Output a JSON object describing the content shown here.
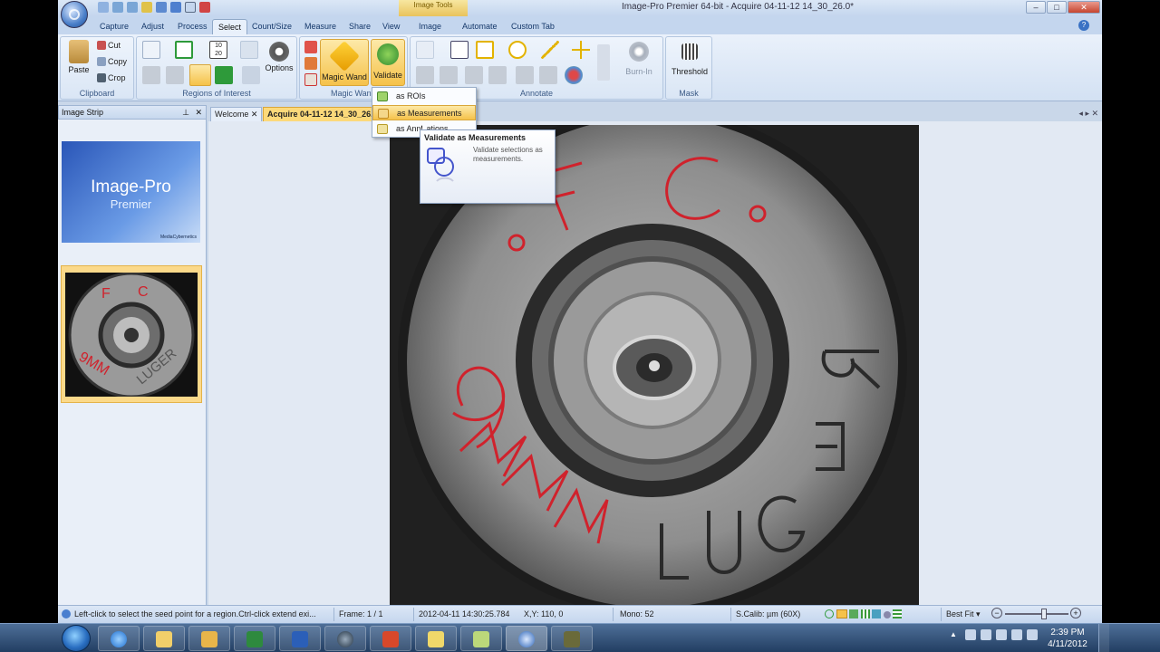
{
  "window": {
    "title": "Image-Pro Premier 64-bit - Acquire 04-11-12 14_30_26.0*",
    "context_tab_title": "Image Tools",
    "minimize_glyph": "–",
    "maximize_glyph": "□",
    "close_glyph": "✕"
  },
  "tabs": [
    "Capture",
    "Adjust",
    "Process",
    "Select",
    "Count/Size",
    "Measure",
    "Share",
    "View",
    "Image",
    "Automate",
    "Custom Tab"
  ],
  "active_tab": "Select",
  "help_glyph": "?",
  "ribbon": {
    "clipboard": {
      "label": "Clipboard",
      "paste": "Paste",
      "cut": "Cut",
      "copy": "Copy",
      "crop": "Crop"
    },
    "roi": {
      "label": "Regions of Interest",
      "options": "Options",
      "counter": "10\n20"
    },
    "magic": {
      "label": "Magic Wand",
      "magic_wand": "Magic Wand",
      "validate": "Validate"
    },
    "annotate": {
      "label": "Annotate",
      "burn_in": "Burn-In"
    },
    "mask": {
      "label": "Mask",
      "threshold": "Threshold"
    }
  },
  "validate_menu": {
    "items": [
      "as ROIs",
      "as Measurements",
      "as Annotations"
    ],
    "selected": "as Measurements",
    "visible_third_prefix": "as Ann",
    "visible_third_suffix": "ations"
  },
  "tooltip": {
    "title": "Validate as Measurements",
    "description": "Validate selections as measurements."
  },
  "image_strip": {
    "title": "Image Strip",
    "pin_glyph": "⊥",
    "close_glyph": "✕",
    "thumb_logo_line1": "Image-Pro",
    "thumb_logo_line2": "Premier",
    "thumb_logo_small": "MediaCybernetics"
  },
  "doc_tabs": {
    "welcome": "Welcome",
    "acquire": "Acquire 04-11-12 14_30_26.0",
    "close_glyph": "✕",
    "nav": "◂ ▸ ✕"
  },
  "status_bar": {
    "hint": "Left-click to select the seed point for a region.Ctrl-click extend exi...",
    "frame": "Frame: 1 / 1",
    "timestamp": "2012-04-11 14:30:25.784",
    "xy": "X,Y: 110,  0",
    "mono": "Mono:      52",
    "calib": "S.Calib: µm (60X)",
    "zoom": "Best Fit"
  },
  "taskbar": {
    "time": "2:39 PM",
    "date": "4/11/2012"
  },
  "colors": {
    "accent": "#f5c24a",
    "ribbon_bg": "#dae6f5",
    "frame_bg": "#c9d7e9",
    "red_overlay": "#d0222c"
  }
}
